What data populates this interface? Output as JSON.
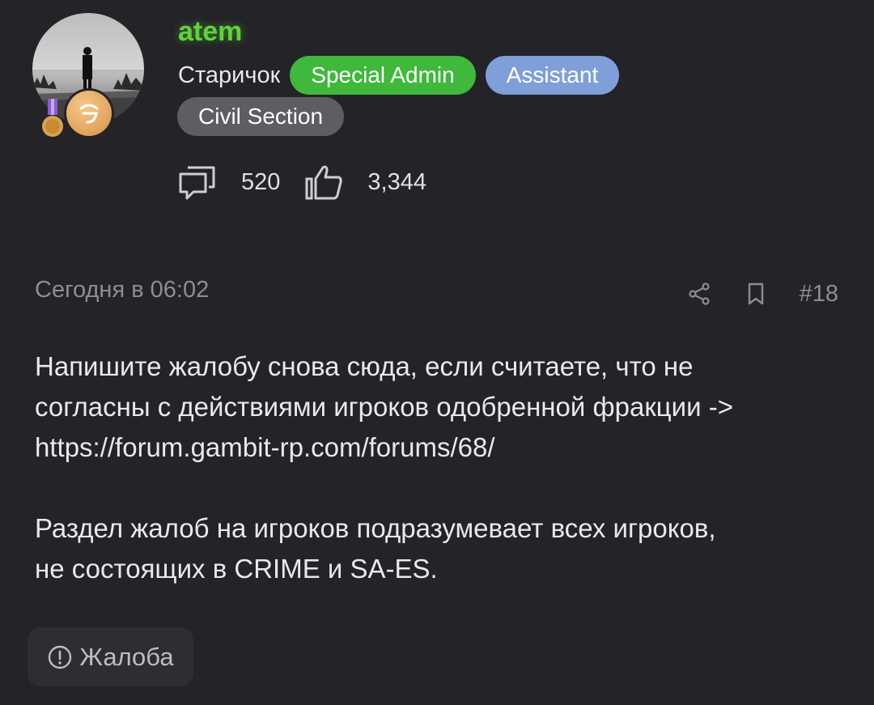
{
  "user": {
    "name": "atem",
    "rank_title": "Старичок",
    "badges": [
      "Special Admin",
      "Assistant",
      "Civil Section"
    ],
    "messages_count": "520",
    "reactions_count": "3,344",
    "name_color": "#5fd33a"
  },
  "post": {
    "date": "Сегодня в 06:02",
    "number": "#18",
    "paragraph1_line1": "Напишите жалобу снова сюда, если считаете, что не",
    "paragraph1_line2": "согласны с действиями игроков одобренной фракции ->",
    "link": "https://forum.gambit-rp.com/forums/68/",
    "paragraph2_line1": "Раздел жалоб на игроков подразумевает всех игроков,",
    "paragraph2_line2": "не состоящих в CRIME и SA-ES."
  },
  "actions": {
    "report_label": "Жалоба"
  },
  "icons": {
    "messages": "messages-icon",
    "reactions": "thumbs-up-icon",
    "share": "share-icon",
    "bookmark": "bookmark-icon",
    "report": "alert-circle-icon"
  },
  "colors": {
    "background": "#232328",
    "badge_special_admin": "#3fb83b",
    "badge_assistant": "#7f9fd8",
    "badge_civil_section": "#5e5e62"
  }
}
